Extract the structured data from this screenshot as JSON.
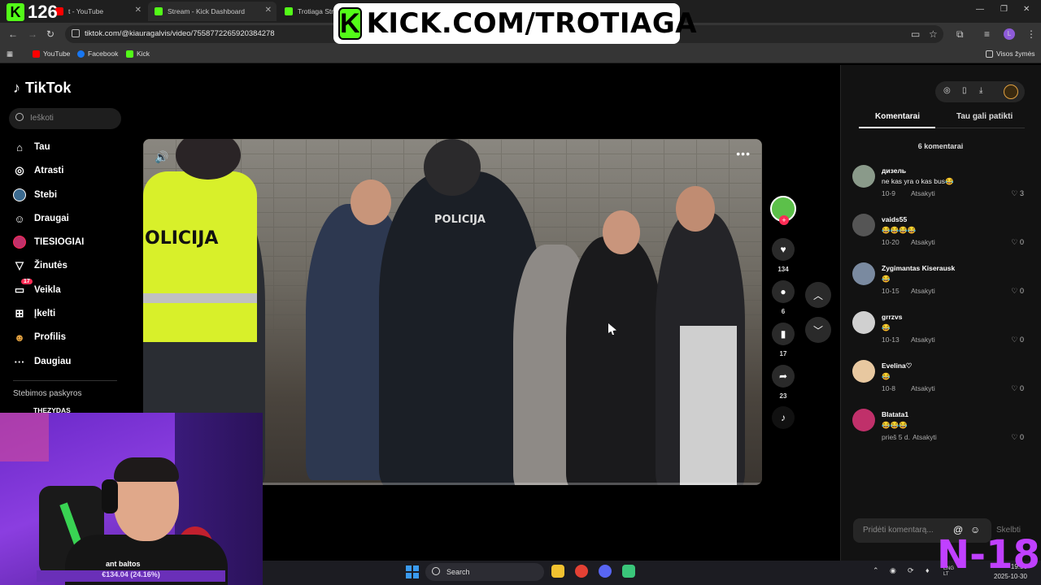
{
  "browser": {
    "tabs": [
      {
        "label": "t - YouTube",
        "color": "#ff0000"
      },
      {
        "label": "Stream - Kick Dashboard",
        "color": "#53fc18"
      },
      {
        "label": "Trotiaga Stre",
        "color": "#53fc18"
      }
    ],
    "url": "tiktok.com/@kiauragalvis/video/7558772265920384278",
    "bookmarks": [
      {
        "label": "YouTube",
        "color": "#ff0000"
      },
      {
        "label": "Facebook",
        "color": "#1877f2"
      },
      {
        "label": "Kick",
        "color": "#53fc18"
      }
    ],
    "all_bookmarks": "Visos žymės",
    "profile_initial": "L"
  },
  "overlay": {
    "kick_banner": "KICK.COM/TROTIAGA",
    "kick_logo": "K",
    "viewer_count": "126",
    "age_badge": "N-18"
  },
  "tiktok": {
    "logo": "TikTok",
    "search_placeholder": "Ieškoti",
    "nav": [
      {
        "label": "Tau",
        "icon": "home-icon"
      },
      {
        "label": "Atrasti",
        "icon": "compass-icon"
      },
      {
        "label": "Stebi",
        "icon": "following-avatar-icon"
      },
      {
        "label": "Draugai",
        "icon": "friends-icon"
      },
      {
        "label": "TIESIOGIAI",
        "icon": "live-icon"
      },
      {
        "label": "Žinutės",
        "icon": "messages-icon"
      },
      {
        "label": "Veikla",
        "icon": "activity-icon",
        "badge": "17"
      },
      {
        "label": "Įkelti",
        "icon": "upload-icon"
      },
      {
        "label": "Profilis",
        "icon": "profile-icon"
      },
      {
        "label": "Daugiau",
        "icon": "more-icon"
      }
    ],
    "following_title": "Stebimos paskyros",
    "following_first": "THEZYDAS",
    "video": {
      "vest_text": "OLICIJA",
      "back_text": "POLICIJA",
      "progress": 0.19
    },
    "actions": {
      "likes": "134",
      "comments": "6",
      "saves": "17",
      "shares": "23"
    },
    "panel": {
      "tab_comments": "Komentarai",
      "tab_suggest": "Tau gali patikti",
      "comment_count": "6 komentarai",
      "comments": [
        {
          "name": "дизель",
          "text": "ne kas yra o kas bus😂",
          "date": "10-9",
          "reply": "Atsakyti",
          "likes": "3",
          "avatar": "#8a9a8a"
        },
        {
          "name": "vaids55",
          "text": "😂😂😂😂",
          "date": "10-20",
          "reply": "Atsakyti",
          "likes": "0",
          "avatar": "#555555"
        },
        {
          "name": "Zygimantas Kiserausk",
          "text": "😂",
          "date": "10-15",
          "reply": "Atsakyti",
          "likes": "0",
          "avatar": "#7a8aa0"
        },
        {
          "name": "grrzvs",
          "text": "😂",
          "date": "10-13",
          "reply": "Atsakyti",
          "likes": "0",
          "avatar": "#d0d0d0"
        },
        {
          "name": "Evelina♡",
          "text": "😂",
          "date": "10-8",
          "reply": "Atsakyti",
          "likes": "0",
          "avatar": "#e8c8a0"
        },
        {
          "name": "Blatata1",
          "text": "😂😂😂",
          "date": "prieš 5 d.",
          "reply": "Atsakyti",
          "likes": "0",
          "avatar": "#c0306a"
        }
      ],
      "input_placeholder": "Pridėti komentarą...",
      "post_label": "Skelbti"
    }
  },
  "webcam": {
    "caption": "ant baltos",
    "money": "€134.04 (24.16%)"
  },
  "taskbar": {
    "search_label": "Search",
    "lang": "ENG\nLT",
    "time": "19:56",
    "date": "2025-10-30"
  }
}
